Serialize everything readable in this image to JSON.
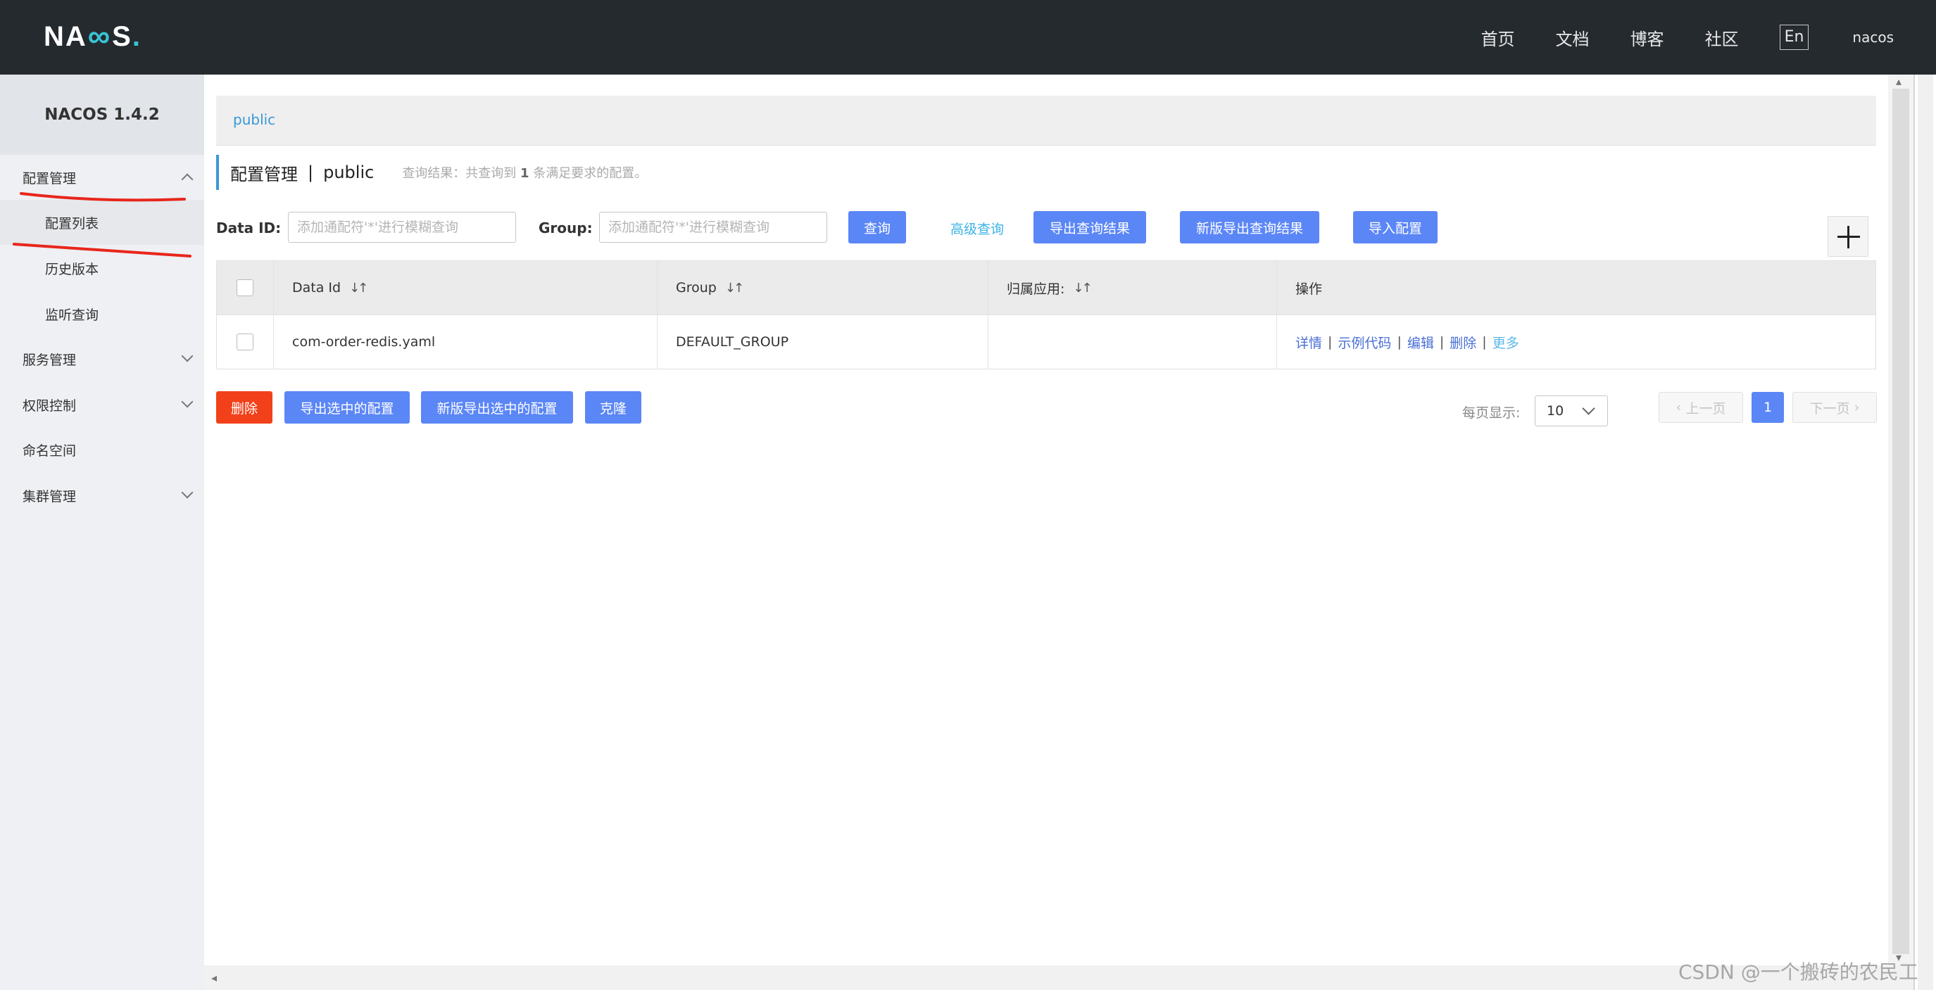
{
  "header": {
    "logo": "NACOS",
    "nav": [
      "首页",
      "文档",
      "博客",
      "社区"
    ],
    "lang_button": "En",
    "user": "nacos"
  },
  "sidebar": {
    "version": "NACOS 1.4.2",
    "items": [
      {
        "label": "配置管理",
        "expanded": true
      },
      {
        "label": "配置列表",
        "sub": true,
        "active": true
      },
      {
        "label": "历史版本",
        "sub": true
      },
      {
        "label": "监听查询",
        "sub": true
      },
      {
        "label": "服务管理",
        "expanded": false
      },
      {
        "label": "权限控制",
        "expanded": false
      },
      {
        "label": "命名空间"
      },
      {
        "label": "集群管理",
        "expanded": false
      }
    ]
  },
  "main": {
    "namespace_tab": "public",
    "title": "配置管理",
    "title_sep": "|",
    "title_ns": "public",
    "result_prefix": "查询结果：共查询到",
    "result_count": "1",
    "result_suffix": "条满足要求的配置。",
    "filters": {
      "data_id_label": "Data ID:",
      "data_id_placeholder": "添加通配符'*'进行模糊查询",
      "group_label": "Group:",
      "group_placeholder": "添加通配符'*'进行模糊查询"
    },
    "buttons": {
      "query": "查询",
      "advanced": "高级查询",
      "export_results": "导出查询结果",
      "new_export_results": "新版导出查询结果",
      "import": "导入配置",
      "delete": "删除",
      "export_selected": "导出选中的配置",
      "new_export_selected": "新版导出选中的配置",
      "clone": "克隆"
    },
    "table": {
      "columns": [
        "Data Id",
        "Group",
        "归属应用:",
        "操作"
      ],
      "rows": [
        {
          "data_id": "com-order-redis.yaml",
          "group": "DEFAULT_GROUP",
          "app": ""
        }
      ],
      "ops": [
        "详情",
        "示例代码",
        "编辑",
        "删除",
        "更多"
      ],
      "op_sep": "|"
    },
    "pagination": {
      "per_page_label": "每页显示:",
      "per_page_value": "10",
      "prev": "上一页",
      "current": "1",
      "next": "下一页"
    }
  },
  "watermark": "CSDN @一个搬砖的农民工",
  "colors": {
    "header_bg": "#252a2f",
    "accent": "#5b86f6",
    "danger": "#f2411a",
    "link": "#3b97d8",
    "annotation_red": "#e8261c"
  }
}
